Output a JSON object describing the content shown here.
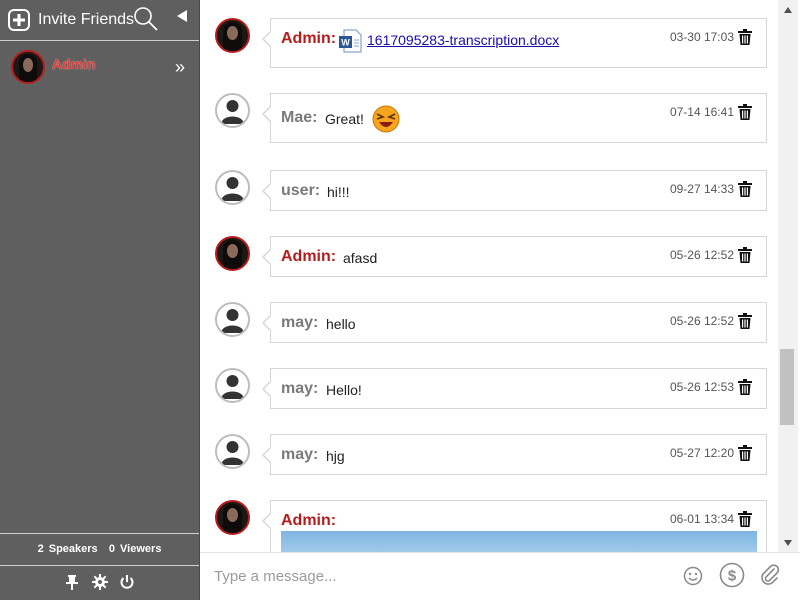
{
  "sidebar": {
    "invite_label": "Invite Friends",
    "user": {
      "name": "Admin"
    },
    "stats": {
      "speakers_count": "2",
      "speakers_label": "Speakers",
      "viewers_count": "0",
      "viewers_label": "Viewers"
    }
  },
  "messages": [
    {
      "sender": "Admin:",
      "role": "admin",
      "file": "1617095283-transcription.docx",
      "file_icon": "word-doc-icon",
      "time": "03-30 17:03"
    },
    {
      "sender": "Mae:",
      "role": "user",
      "text": "Great!",
      "emoji": "laughing-emoji",
      "time": "07-14 16:41"
    },
    {
      "sender": "user:",
      "role": "user",
      "text": "hi!!!",
      "time": "09-27 14:33"
    },
    {
      "sender": "Admin:",
      "role": "admin",
      "text": "afasd",
      "time": "05-26 12:52"
    },
    {
      "sender": "may:",
      "role": "user",
      "text": "hello",
      "time": "05-26 12:52"
    },
    {
      "sender": "may:",
      "role": "user",
      "text": "Hello!",
      "time": "05-26 12:53"
    },
    {
      "sender": "may:",
      "role": "user",
      "text": "hjg",
      "time": "05-27 12:20"
    },
    {
      "sender": "Admin:",
      "role": "admin",
      "time": "06-01 13:34",
      "attachment": "image"
    }
  ],
  "composer": {
    "placeholder": "Type a message..."
  },
  "colors": {
    "sidebar_bg": "#5f5f5f",
    "admin_name": "#b71c1c",
    "user_name": "#7a7a7a",
    "link": "#1a0dab"
  }
}
